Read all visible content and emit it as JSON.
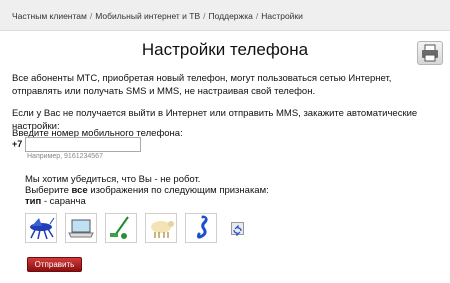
{
  "breadcrumb": [
    "Частным клиентам",
    "Мобильный интернет и ТВ",
    "Поддержка",
    "Настройки"
  ],
  "breadcrumb_separator": "/",
  "page_title": "Настройки телефона",
  "intro_text": "Все абоненты МТС, приобретая новый телефон, могут пользоваться сетью Интернет, отправлять или получать SMS и MMS, не настраивая свой телефон.",
  "auto_settings_text": "Если у Вас не получается выйти в Интернет или отправить MMS, закажите автоматические настройки:",
  "phone_form": {
    "label": "Введите номер мобильного телефона:",
    "prefix": "+7",
    "value": "",
    "hint": "Например, 9161234567"
  },
  "captcha": {
    "line1": "Мы хотим убедиться, что Вы - не робот.",
    "line2_before": "Выберите ",
    "line2_bold": "все",
    "line2_after": " изображения по следующим признакам:",
    "criterion_key": "тип",
    "criterion_value": " - саранча",
    "images": [
      "locust-icon",
      "laptop-icon",
      "golf-club-icon",
      "sheep-icon",
      "seahorse-icon"
    ]
  },
  "submit_label": "Отправить",
  "colors": {
    "brand_red": "#c0161b",
    "topbar_bg": "#efefef"
  }
}
